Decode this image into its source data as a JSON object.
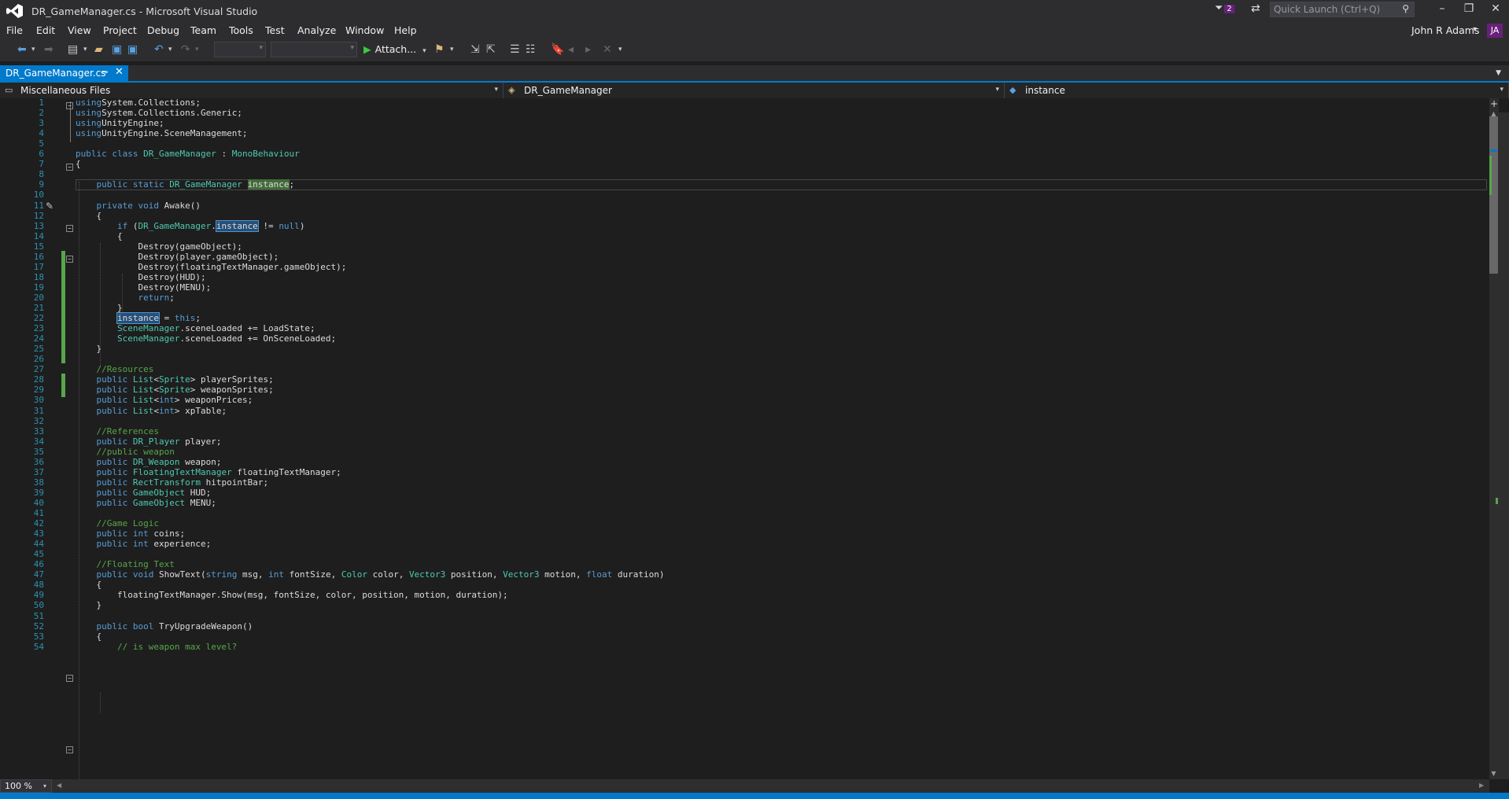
{
  "window": {
    "title": "DR_GameManager.cs - Microsoft Visual Studio",
    "notification_count": "2"
  },
  "quick_launch": {
    "placeholder": "Quick Launch (Ctrl+Q)"
  },
  "menu": {
    "items": [
      "File",
      "Edit",
      "View",
      "Project",
      "Debug",
      "Team",
      "Tools",
      "Test",
      "Analyze",
      "Window",
      "Help"
    ]
  },
  "user": {
    "name": "John R Adams",
    "initials": "JA"
  },
  "toolbar": {
    "attach_label": "Attach..."
  },
  "tab": {
    "filename": "DR_GameManager.cs"
  },
  "navbar": {
    "project": "Miscellaneous Files",
    "class": "DR_GameManager",
    "member": "instance"
  },
  "editor": {
    "zoom": "100 %",
    "current_line": 9,
    "lines": [
      [
        [
          "kw",
          "using"
        ],
        [
          "",
          "System.Collections;"
        ]
      ],
      [
        [
          "kw",
          "using"
        ],
        [
          "",
          "System.Collections.Generic;"
        ]
      ],
      [
        [
          "kw",
          "using"
        ],
        [
          "",
          "UnityEngine;"
        ]
      ],
      [
        [
          "kw",
          "using"
        ],
        [
          "",
          "UnityEngine.SceneManagement;"
        ]
      ],
      [],
      [
        [
          "kw",
          "public class"
        ],
        [
          "",
          " "
        ],
        [
          "ty",
          "DR_GameManager"
        ],
        [
          "",
          " : "
        ],
        [
          "ty",
          "MonoBehaviour"
        ]
      ],
      [
        [
          "",
          "{"
        ]
      ],
      [],
      [
        [
          "",
          "    "
        ],
        [
          "kw",
          "public static"
        ],
        [
          "",
          " "
        ],
        [
          "ty",
          "DR_GameManager"
        ],
        [
          "",
          " "
        ],
        [
          "hl-def",
          "instance"
        ],
        [
          "",
          ";"
        ]
      ],
      [],
      [
        [
          "",
          "    "
        ],
        [
          "kw",
          "private void"
        ],
        [
          "",
          " Awake()"
        ]
      ],
      [
        [
          "",
          "    {"
        ]
      ],
      [
        [
          "",
          "        "
        ],
        [
          "kw",
          "if"
        ],
        [
          "",
          " ("
        ],
        [
          "ty",
          "DR_GameManager"
        ],
        [
          "",
          "."
        ],
        [
          "hl-ref",
          "instance"
        ],
        [
          "",
          " != "
        ],
        [
          "kw",
          "null"
        ],
        [
          "",
          ")"
        ]
      ],
      [
        [
          "",
          "        {"
        ]
      ],
      [
        [
          "",
          "            Destroy(gameObject);"
        ]
      ],
      [
        [
          "",
          "            Destroy(player.gameObject);"
        ]
      ],
      [
        [
          "",
          "            Destroy(floatingTextManager.gameObject);"
        ]
      ],
      [
        [
          "",
          "            Destroy(HUD);"
        ]
      ],
      [
        [
          "",
          "            Destroy(MENU);"
        ]
      ],
      [
        [
          "",
          "            "
        ],
        [
          "kw",
          "return"
        ],
        [
          "",
          ";"
        ]
      ],
      [
        [
          "",
          "        }"
        ]
      ],
      [
        [
          "",
          "        "
        ],
        [
          "hl-ref",
          "instance"
        ],
        [
          "",
          " = "
        ],
        [
          "kw",
          "this"
        ],
        [
          "",
          ";"
        ]
      ],
      [
        [
          "",
          "        "
        ],
        [
          "ty",
          "SceneManager"
        ],
        [
          "",
          ".sceneLoaded += LoadState;"
        ]
      ],
      [
        [
          "",
          "        "
        ],
        [
          "ty",
          "SceneManager"
        ],
        [
          "",
          ".sceneLoaded += OnSceneLoaded;"
        ]
      ],
      [
        [
          "",
          "    }"
        ]
      ],
      [],
      [
        [
          "",
          "    "
        ],
        [
          "cm",
          "//Resources"
        ]
      ],
      [
        [
          "",
          "    "
        ],
        [
          "kw",
          "public"
        ],
        [
          "",
          " "
        ],
        [
          "ty",
          "List"
        ],
        [
          "",
          "<"
        ],
        [
          "ty",
          "Sprite"
        ],
        [
          "",
          "> playerSprites;"
        ]
      ],
      [
        [
          "",
          "    "
        ],
        [
          "kw",
          "public"
        ],
        [
          "",
          " "
        ],
        [
          "ty",
          "List"
        ],
        [
          "",
          "<"
        ],
        [
          "ty",
          "Sprite"
        ],
        [
          "",
          "> weaponSprites;"
        ]
      ],
      [
        [
          "",
          "    "
        ],
        [
          "kw",
          "public"
        ],
        [
          "",
          " "
        ],
        [
          "ty",
          "List"
        ],
        [
          "",
          "<"
        ],
        [
          "kw",
          "int"
        ],
        [
          "",
          "> weaponPrices;"
        ]
      ],
      [
        [
          "",
          "    "
        ],
        [
          "kw",
          "public"
        ],
        [
          "",
          " "
        ],
        [
          "ty",
          "List"
        ],
        [
          "",
          "<"
        ],
        [
          "kw",
          "int"
        ],
        [
          "",
          "> xpTable;"
        ]
      ],
      [],
      [
        [
          "",
          "    "
        ],
        [
          "cm",
          "//References"
        ]
      ],
      [
        [
          "",
          "    "
        ],
        [
          "kw",
          "public"
        ],
        [
          "",
          " "
        ],
        [
          "ty",
          "DR_Player"
        ],
        [
          "",
          " player;"
        ]
      ],
      [
        [
          "",
          "    "
        ],
        [
          "cm",
          "//public weapon"
        ]
      ],
      [
        [
          "",
          "    "
        ],
        [
          "kw",
          "public"
        ],
        [
          "",
          " "
        ],
        [
          "ty",
          "DR_Weapon"
        ],
        [
          "",
          " weapon;"
        ]
      ],
      [
        [
          "",
          "    "
        ],
        [
          "kw",
          "public"
        ],
        [
          "",
          " "
        ],
        [
          "ty",
          "FloatingTextManager"
        ],
        [
          "",
          " floatingTextManager;"
        ]
      ],
      [
        [
          "",
          "    "
        ],
        [
          "kw",
          "public"
        ],
        [
          "",
          " "
        ],
        [
          "ty",
          "RectTransform"
        ],
        [
          "",
          " hitpointBar;"
        ]
      ],
      [
        [
          "",
          "    "
        ],
        [
          "kw",
          "public"
        ],
        [
          "",
          " "
        ],
        [
          "ty",
          "GameObject"
        ],
        [
          "",
          " HUD;"
        ]
      ],
      [
        [
          "",
          "    "
        ],
        [
          "kw",
          "public"
        ],
        [
          "",
          " "
        ],
        [
          "ty",
          "GameObject"
        ],
        [
          "",
          " MENU;"
        ]
      ],
      [],
      [
        [
          "",
          "    "
        ],
        [
          "cm",
          "//Game Logic"
        ]
      ],
      [
        [
          "",
          "    "
        ],
        [
          "kw",
          "public int"
        ],
        [
          "",
          " coins;"
        ]
      ],
      [
        [
          "",
          "    "
        ],
        [
          "kw",
          "public int"
        ],
        [
          "",
          " experience;"
        ]
      ],
      [],
      [
        [
          "",
          "    "
        ],
        [
          "cm",
          "//Floating Text"
        ]
      ],
      [
        [
          "",
          "    "
        ],
        [
          "kw",
          "public void"
        ],
        [
          "",
          " ShowText("
        ],
        [
          "kw",
          "string"
        ],
        [
          "",
          " msg, "
        ],
        [
          "kw",
          "int"
        ],
        [
          "",
          " fontSize, "
        ],
        [
          "ty",
          "Color"
        ],
        [
          "",
          " color, "
        ],
        [
          "ty",
          "Vector3"
        ],
        [
          "",
          " position, "
        ],
        [
          "ty",
          "Vector3"
        ],
        [
          "",
          " motion, "
        ],
        [
          "kw",
          "float"
        ],
        [
          "",
          " duration)"
        ]
      ],
      [
        [
          "",
          "    {"
        ]
      ],
      [
        [
          "",
          "        floatingTextManager.Show(msg, fontSize, color, position, motion, duration);"
        ]
      ],
      [
        [
          "",
          "    }"
        ]
      ],
      [],
      [
        [
          "",
          "    "
        ],
        [
          "kw",
          "public bool"
        ],
        [
          "",
          " TryUpgradeWeapon()"
        ]
      ],
      [
        [
          "",
          "    {"
        ]
      ],
      [
        [
          "",
          "        "
        ],
        [
          "cm",
          "// is weapon max level?"
        ]
      ]
    ]
  }
}
